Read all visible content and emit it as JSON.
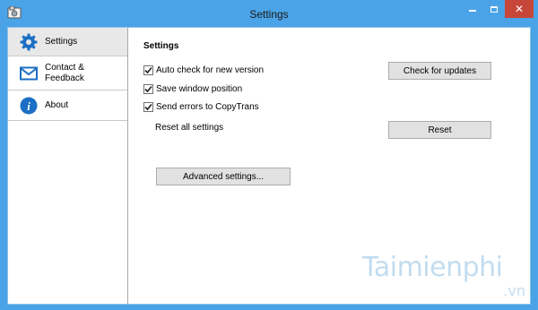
{
  "window": {
    "title": "Settings",
    "app_icon": "copytrans-app-icon"
  },
  "titlebar_buttons": {
    "minimize": "minimize-icon",
    "maximize": "maximize-icon",
    "close": "close-icon"
  },
  "sidebar": {
    "items": [
      {
        "label": "Settings",
        "icon": "gear-icon",
        "active": true
      },
      {
        "label": "Contact &\nFeedback",
        "icon": "envelope-icon",
        "active": false
      },
      {
        "label": "About",
        "icon": "info-icon",
        "active": false
      }
    ]
  },
  "settings": {
    "title": "Settings",
    "options": [
      {
        "label": "Auto check for new version",
        "checked": true
      },
      {
        "label": "Save window position",
        "checked": true
      },
      {
        "label": "Send errors to CopyTrans",
        "checked": true
      }
    ],
    "reset_label": "Reset all settings",
    "check_updates_button": "Check for updates",
    "reset_button": "Reset",
    "advanced_button": "Advanced settings..."
  },
  "watermark": {
    "main": "Taimienphi",
    "sub": ".vn"
  },
  "colors": {
    "titlebar": "#4aa3e6",
    "close_button": "#c7463a",
    "sidebar_active": "#e8e8e8",
    "icon_blue": "#1c6fc4"
  }
}
